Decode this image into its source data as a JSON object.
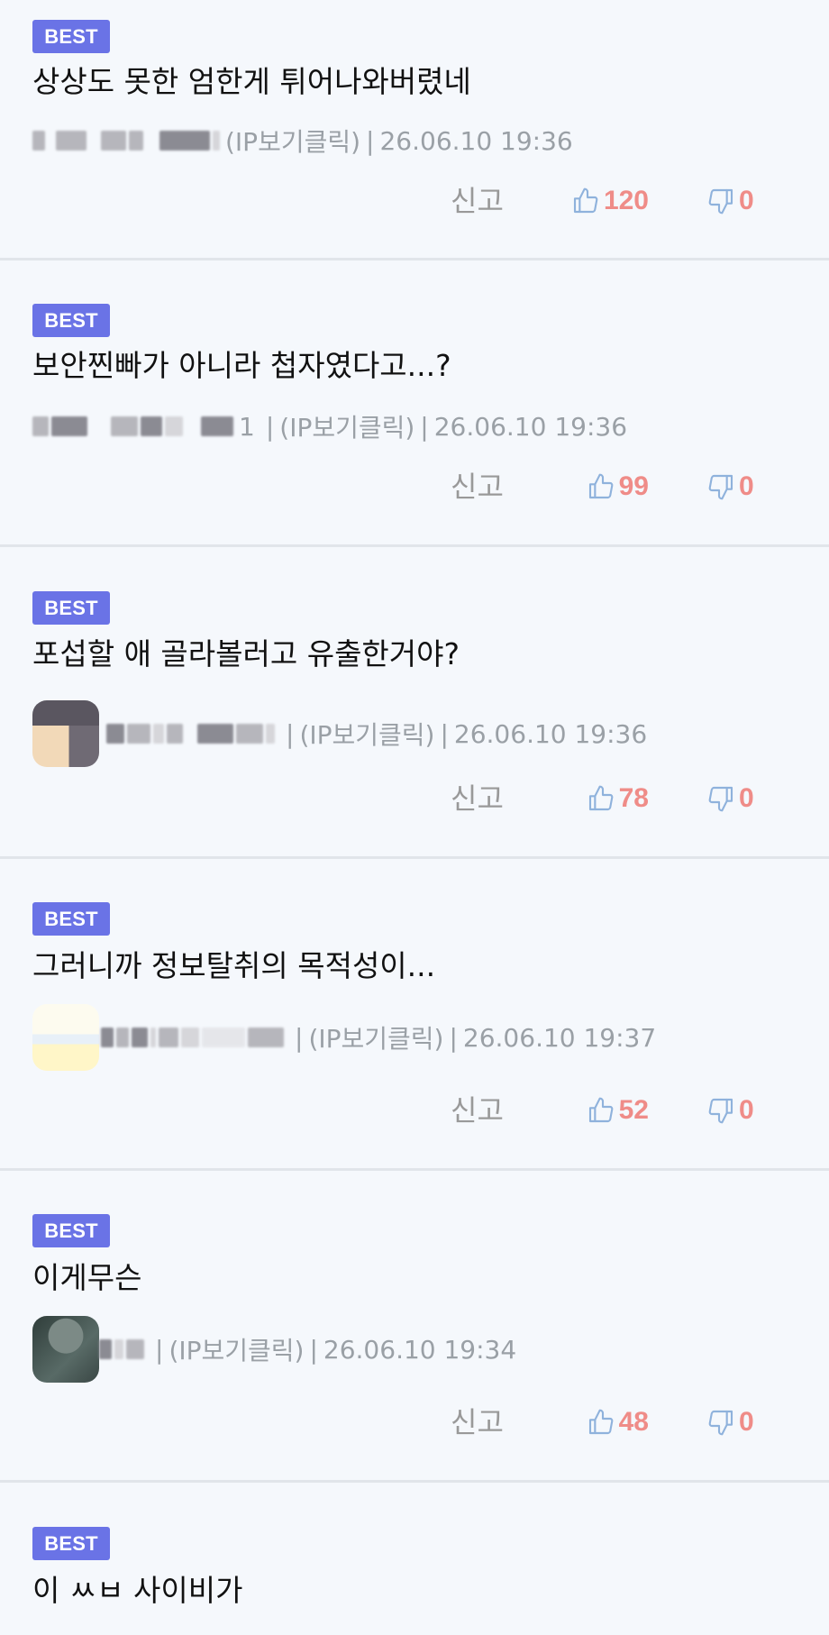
{
  "labels": {
    "best": "BEST",
    "report": "신고",
    "ip_view": "(IP보기클릭)",
    "separator": "|"
  },
  "colors": {
    "best_badge": "#6a73e6",
    "like_icon": "#8fb2dc",
    "count": "#ef8c88",
    "meta": "#9aa0a6",
    "background": "#f5f8fc"
  },
  "comments": [
    {
      "text": "상상도 못한 엄한게 튀어나와버렸네",
      "avatar": false,
      "nickname_visible": "",
      "date": "26.06.10 19:36",
      "likes": "120",
      "dislikes": "0"
    },
    {
      "text": "보안찐빠가 아니라 첩자였다고...?",
      "avatar": false,
      "nickname_visible": "1",
      "date": "26.06.10 19:36",
      "likes": "99",
      "dislikes": "0"
    },
    {
      "text": "포섭할 애 골라볼러고 유출한거야?",
      "avatar": true,
      "nickname_visible": "",
      "date": "26.06.10 19:36",
      "likes": "78",
      "dislikes": "0"
    },
    {
      "text": "그러니까 정보탈취의 목적성이...",
      "avatar": true,
      "nickname_visible": "",
      "date": "26.06.10 19:37",
      "likes": "52",
      "dislikes": "0"
    },
    {
      "text": "이게무슨",
      "avatar": true,
      "nickname_visible": "",
      "date": "26.06.10 19:34",
      "likes": "48",
      "dislikes": "0"
    },
    {
      "text": "이 ㅆㅂ 사이비가"
    }
  ]
}
